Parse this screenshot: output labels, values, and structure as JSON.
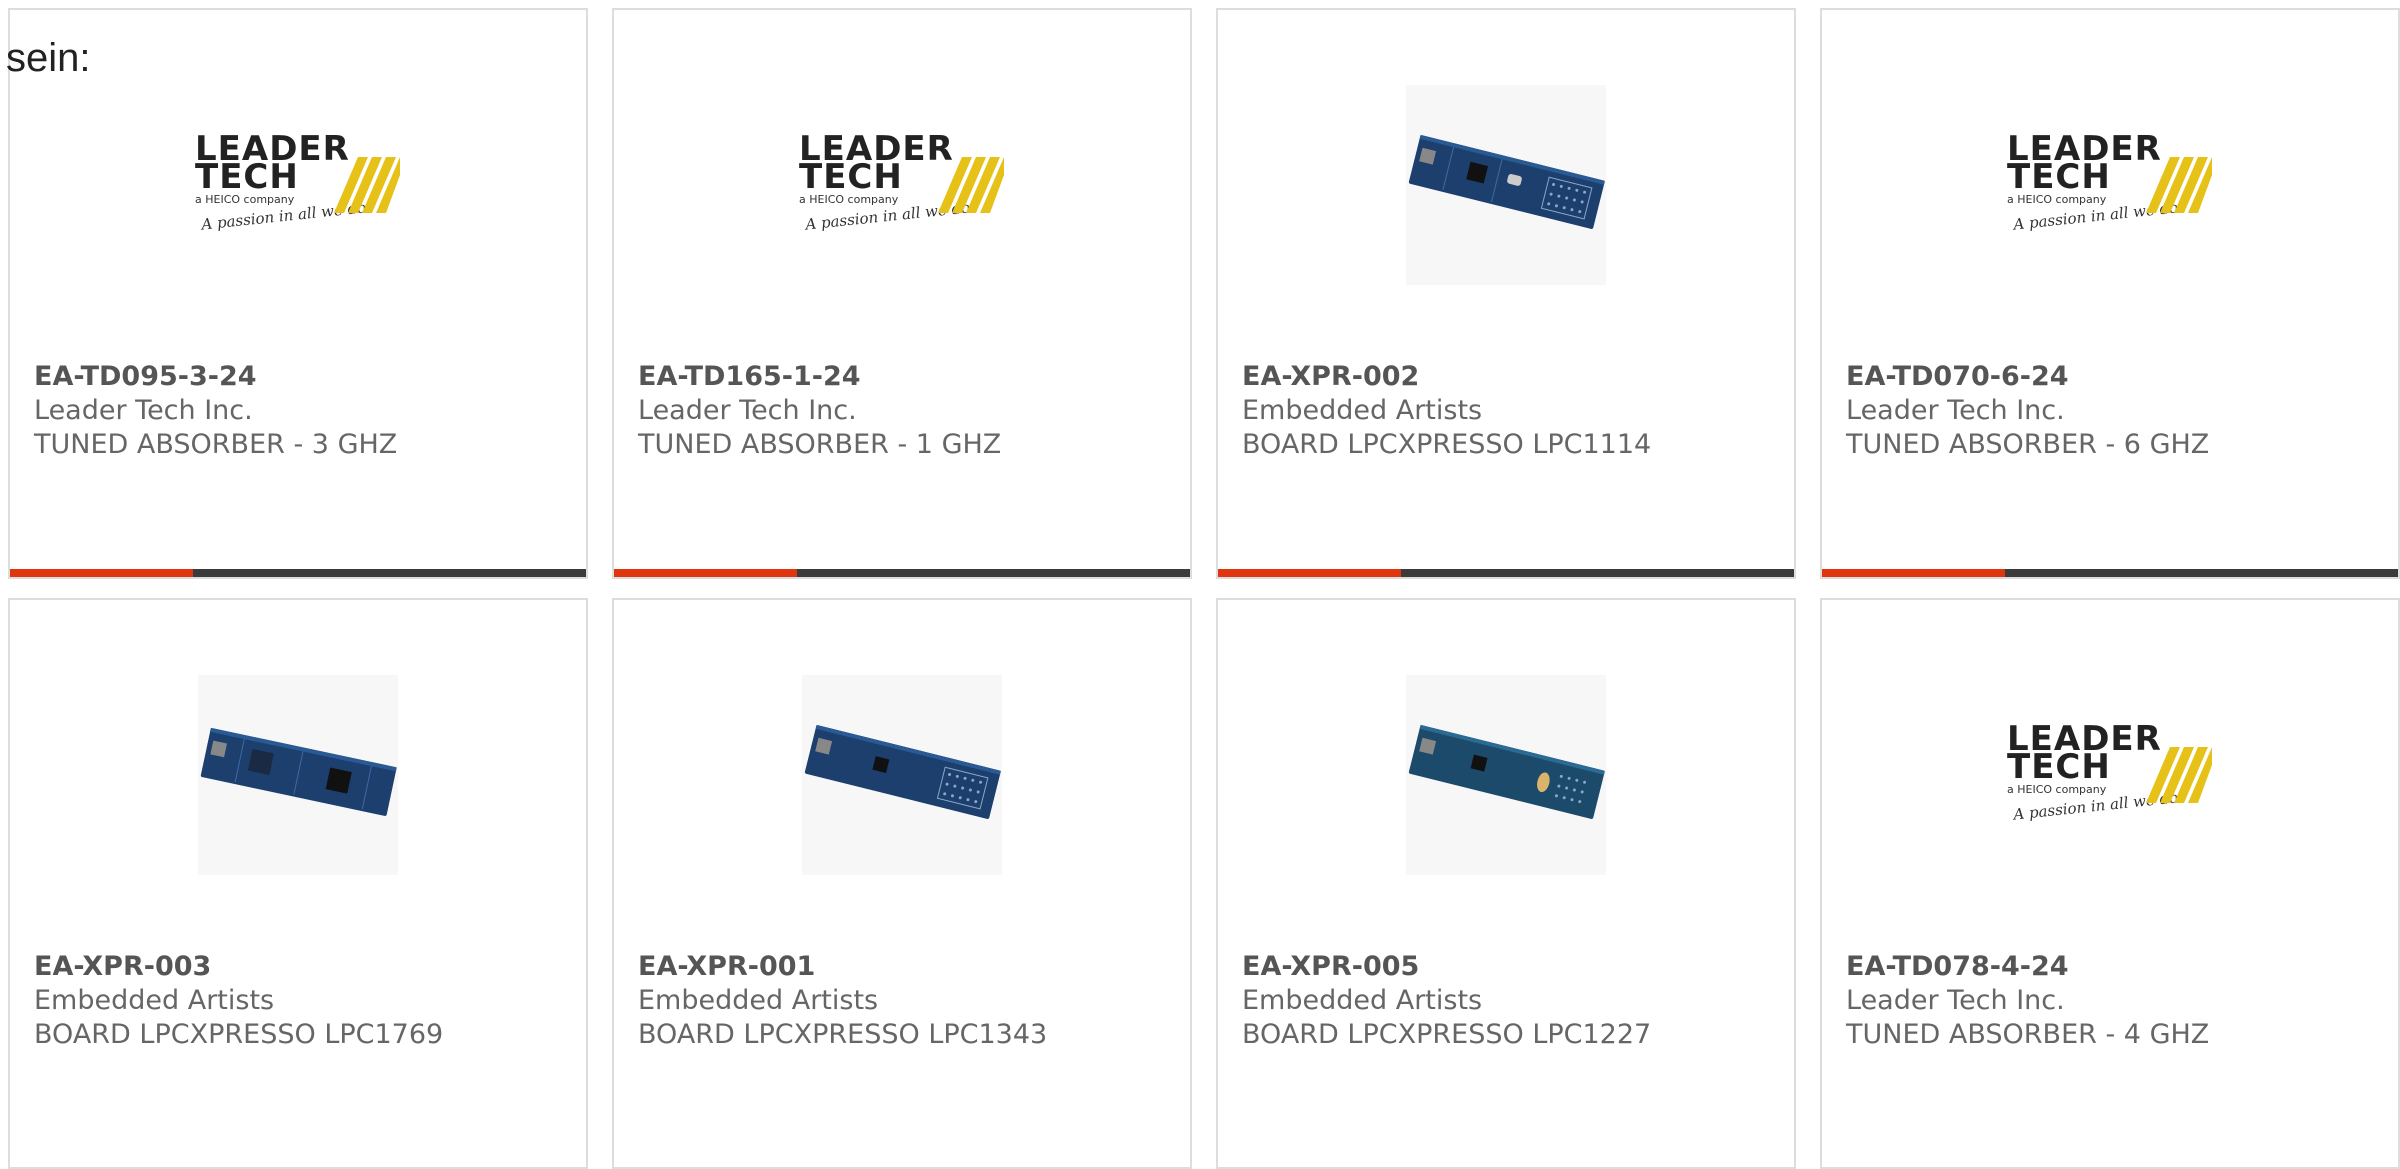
{
  "intro_text": "sein:",
  "colors": {
    "accent": "#e0360f",
    "bar_dark": "#3b3b3b",
    "border": "#dddddd",
    "logo_yellow": "#e6c118"
  },
  "cards": [
    {
      "part_number": "EA-TD095-3-24",
      "manufacturer": "Leader Tech Inc.",
      "description": "TUNED ABSORBER - 3 GHZ",
      "image": "leader-tech-logo"
    },
    {
      "part_number": "EA-TD165-1-24",
      "manufacturer": "Leader Tech Inc.",
      "description": "TUNED ABSORBER - 1 GHZ",
      "image": "leader-tech-logo"
    },
    {
      "part_number": "EA-XPR-002",
      "manufacturer": "Embedded Artists",
      "description": "BOARD LPCXPRESSO LPC1114",
      "image": "lpcxpresso-board"
    },
    {
      "part_number": "EA-TD070-6-24",
      "manufacturer": "Leader Tech Inc.",
      "description": "TUNED ABSORBER - 6 GHZ",
      "image": "leader-tech-logo"
    },
    {
      "part_number": "EA-XPR-003",
      "manufacturer": "Embedded Artists",
      "description": "BOARD LPCXPRESSO LPC1769",
      "image": "lpcxpresso-board"
    },
    {
      "part_number": "EA-XPR-001",
      "manufacturer": "Embedded Artists",
      "description": "BOARD LPCXPRESSO LPC1343",
      "image": "lpcxpresso-board"
    },
    {
      "part_number": "EA-XPR-005",
      "manufacturer": "Embedded Artists",
      "description": "BOARD LPCXPRESSO LPC1227",
      "image": "lpcxpresso-board"
    },
    {
      "part_number": "EA-TD078-4-24",
      "manufacturer": "Leader Tech Inc.",
      "description": "TUNED ABSORBER - 4 GHZ",
      "image": "leader-tech-logo"
    }
  ],
  "logo": {
    "line1": "LEADER",
    "line2": "TECH",
    "subline": "a HEICO company",
    "tagline": "A passion in all we do"
  }
}
